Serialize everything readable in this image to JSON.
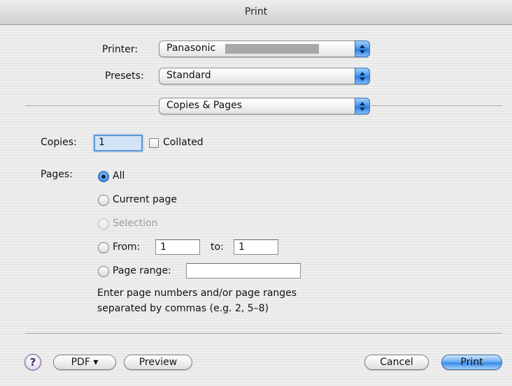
{
  "window": {
    "title": "Print"
  },
  "printer": {
    "label": "Printer:",
    "value": "Panasonic"
  },
  "presets": {
    "label": "Presets:",
    "value": "Standard"
  },
  "panel": {
    "value": "Copies & Pages"
  },
  "copies": {
    "label": "Copies:",
    "value": "1",
    "collated_label": "Collated",
    "collated": false
  },
  "pages": {
    "label": "Pages:",
    "selected": "All",
    "options": {
      "all": "All",
      "current": "Current page",
      "selection": "Selection",
      "from": "From:",
      "to": "to:",
      "range": "Page range:"
    },
    "from_value": "1",
    "to_value": "1",
    "range_value": "",
    "hint_line1": "Enter page numbers and/or page ranges",
    "hint_line2": "separated by commas (e.g. 2, 5–8)"
  },
  "footer": {
    "help": "?",
    "pdf": "PDF ▾",
    "preview": "Preview",
    "cancel": "Cancel",
    "print": "Print"
  },
  "colors": {
    "accent": "#3d8ae8",
    "redaction": "#a8a8a8"
  }
}
